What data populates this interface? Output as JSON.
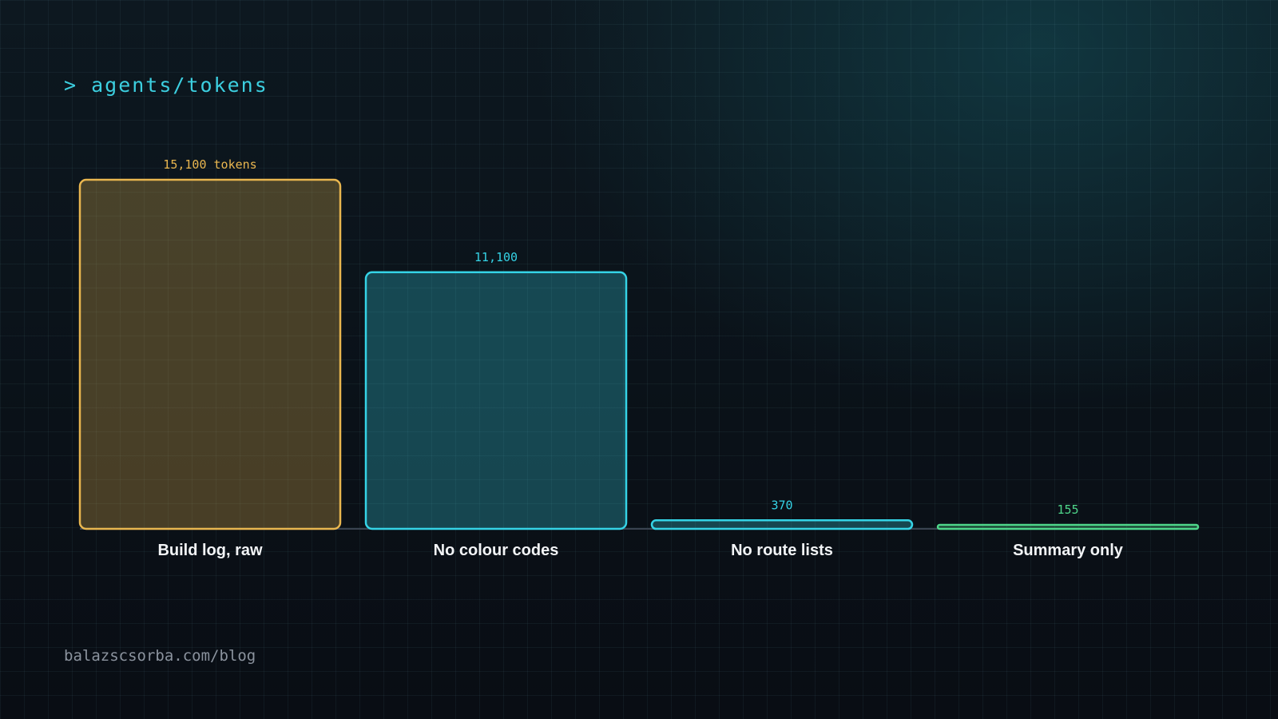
{
  "header": {
    "title": "> agents/tokens"
  },
  "footer": {
    "url": "balazscsorba.com/blog"
  },
  "colors": {
    "gold": "#e9b64f",
    "cyan": "#35d3e6",
    "green": "#4ed68a",
    "baseline": "#3a4350",
    "label_text": "#f2f4f6"
  },
  "chart_data": {
    "type": "bar",
    "title": "",
    "xlabel": "",
    "ylabel": "",
    "ylim": [
      0,
      15100
    ],
    "categories": [
      "Build log, raw",
      "No colour codes",
      "No route lists",
      "Summary only"
    ],
    "values": [
      15100,
      11100,
      370,
      155
    ],
    "value_labels": [
      "15,100 tokens",
      "11,100",
      "370",
      "155"
    ],
    "bar_colors": [
      "#e9b64f",
      "#35d3e6",
      "#35d3e6",
      "#4ed68a"
    ],
    "bar_fills": [
      "rgba(233,182,79,0.28)",
      "rgba(53,211,230,0.28)",
      "rgba(53,211,230,0.28)",
      "rgba(78,214,138,0.28)"
    ],
    "grid": true,
    "legend": "none"
  }
}
